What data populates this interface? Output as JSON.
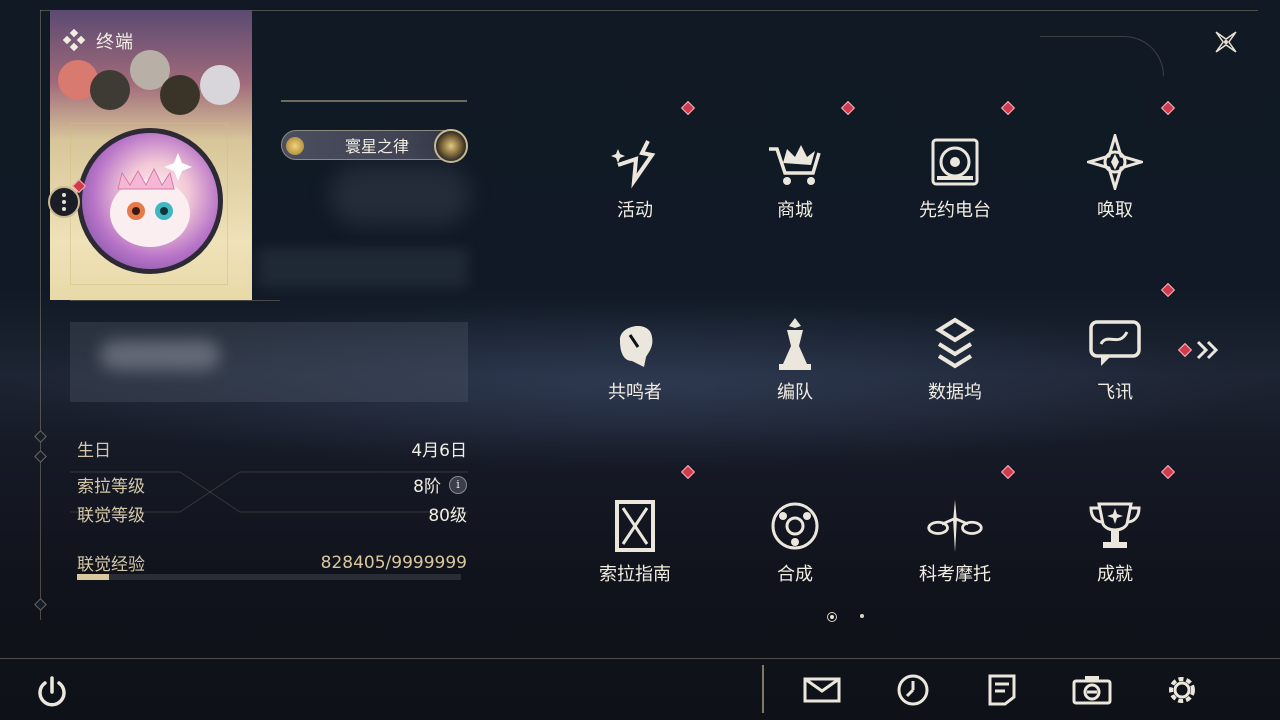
{
  "header": {
    "title": "终端",
    "title_icon": "diamond-cluster-icon",
    "close_icon": "close-star-icon"
  },
  "profile": {
    "title_badge": "寰星之律",
    "menu_icon": "more-vertical-icon",
    "stats": {
      "birthday_label": "生日",
      "birthday_value": "4月6日",
      "sola_level_label": "索拉等级",
      "sola_level_value": "8阶",
      "union_level_label": "联觉等级",
      "union_level_value": "80级",
      "union_exp_label": "联觉经验",
      "union_exp_value": "828405/9999999",
      "union_exp_progress": 0.0828
    },
    "info_glyph": "i"
  },
  "menu": {
    "items": [
      {
        "label": "活动",
        "icon": "events-icon",
        "badge": true
      },
      {
        "label": "商城",
        "icon": "shop-crown-cart-icon",
        "badge": true
      },
      {
        "label": "先约电台",
        "icon": "radio-icon",
        "badge": true
      },
      {
        "label": "唤取",
        "icon": "convene-compass-icon",
        "badge": true
      },
      {
        "label": "共鸣者",
        "icon": "resonator-head-icon",
        "badge": false
      },
      {
        "label": "编队",
        "icon": "team-chess-icon",
        "badge": false
      },
      {
        "label": "数据坞",
        "icon": "data-dock-icon",
        "badge": false
      },
      {
        "label": "飞讯",
        "icon": "message-bubble-icon",
        "badge": true
      },
      {
        "label": "索拉指南",
        "icon": "guide-book-icon",
        "badge": true
      },
      {
        "label": "合成",
        "icon": "synthesis-icon",
        "badge": false
      },
      {
        "label": "科考摩托",
        "icon": "motorbike-icon",
        "badge": true
      },
      {
        "label": "成就",
        "icon": "achievement-trophy-icon",
        "badge": true
      }
    ],
    "next_icon": "double-chevron-right-icon",
    "page_count": 2,
    "current_page": 1
  },
  "bottom": {
    "power_icon": "power-icon",
    "mail_icon": "mail-icon",
    "clock_icon": "clock-icon",
    "notes_icon": "notes-icon",
    "camera_icon": "camera-icon",
    "settings_icon": "gear-icon"
  },
  "colors": {
    "accent": "#d9c8a0",
    "badge_red": "#d23a4c",
    "text": "#f2ede2"
  }
}
